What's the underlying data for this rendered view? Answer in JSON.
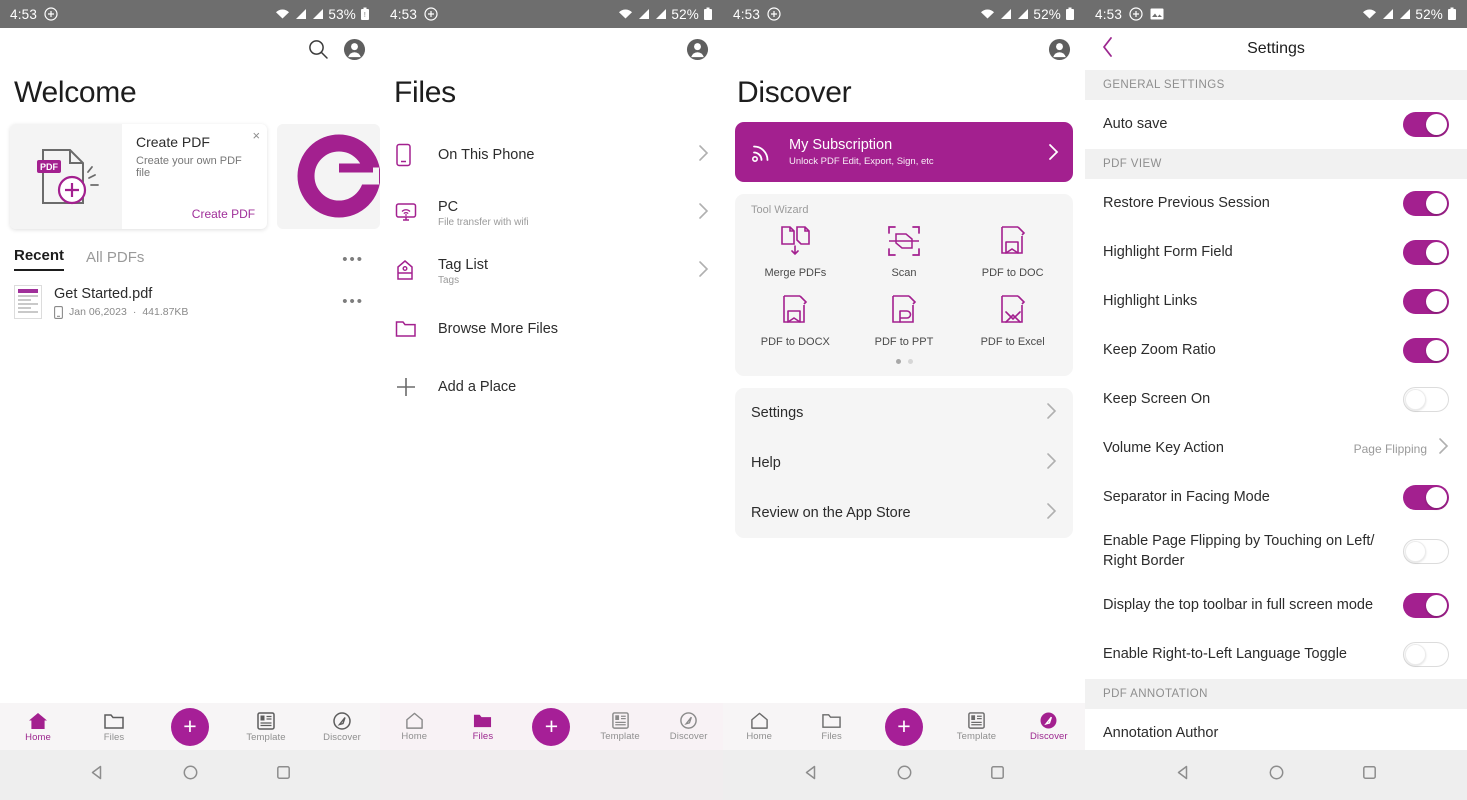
{
  "status_bar": {
    "home": {
      "time": "4:53",
      "battery": "53%",
      "icons": [
        "plus-circle-icon",
        "wifi-icon",
        "signal-icon",
        "signal-icon",
        "battery-icon"
      ]
    },
    "files": {
      "time": "4:53",
      "battery": "52%",
      "icons": [
        "plus-circle-icon",
        "wifi-icon",
        "signal-icon",
        "signal-icon",
        "battery-icon"
      ]
    },
    "discover": {
      "time": "4:53",
      "battery": "52%",
      "icons": [
        "plus-circle-icon",
        "wifi-icon",
        "signal-icon",
        "signal-icon",
        "battery-icon"
      ]
    },
    "settings": {
      "time": "4:53",
      "battery": "52%",
      "icons": [
        "plus-circle-icon",
        "image-icon",
        "wifi-icon",
        "signal-icon",
        "signal-icon",
        "battery-icon"
      ]
    }
  },
  "colors": {
    "brand_purple": "#a3208f",
    "brand_purple_light": "#9c278f",
    "status_bar_gray": "#6e6e6e",
    "nav_bar_gray": "#eeeeee",
    "card_gray": "#f5f5f5"
  },
  "home": {
    "title": "Welcome",
    "promo": {
      "title": "Create PDF",
      "subtitle": "Create your own PDF file",
      "cta": "Create PDF",
      "badge": "PDF",
      "close": "×"
    },
    "tabs": [
      {
        "label": "Recent",
        "active": true
      },
      {
        "label": "All PDFs",
        "active": false
      }
    ],
    "overflow": "•••",
    "files": [
      {
        "name": "Get Started.pdf",
        "date": "Jan 06,2023",
        "separator": "·",
        "size": "441.87KB",
        "overflow": "•••"
      }
    ]
  },
  "files": {
    "title": "Files",
    "items": [
      {
        "label": "On This Phone",
        "sub": "",
        "icon": "phone-icon",
        "chevron": true
      },
      {
        "label": "PC",
        "sub": "File transfer with wifi",
        "icon": "monitor-wifi-icon",
        "chevron": true
      },
      {
        "label": "Tag List",
        "sub": "Tags",
        "icon": "tag-icon",
        "chevron": true
      },
      {
        "label": "Browse More Files",
        "sub": "",
        "icon": "folder-icon",
        "chevron": false
      },
      {
        "label": "Add a Place",
        "sub": "",
        "icon": "plus-icon",
        "chevron": false
      }
    ]
  },
  "discover": {
    "title": "Discover",
    "subscription": {
      "title": "My Subscription",
      "subtitle": "Unlock PDF Edit, Export, Sign, etc",
      "icon": "rss-icon"
    },
    "tool_wizard": {
      "header": "Tool Wizard",
      "tools": [
        {
          "label": "Merge PDFs",
          "icon": "merge-pdfs-icon"
        },
        {
          "label": "Scan",
          "icon": "scan-icon"
        },
        {
          "label": "PDF to DOC",
          "icon": "pdf-to-doc-icon"
        },
        {
          "label": "PDF to DOCX",
          "icon": "pdf-to-docx-icon"
        },
        {
          "label": "PDF to PPT",
          "icon": "pdf-to-ppt-icon"
        },
        {
          "label": "PDF to Excel",
          "icon": "pdf-to-excel-icon"
        }
      ],
      "page_dots": 2,
      "active_dot": 0
    },
    "menu": [
      {
        "label": "Settings"
      },
      {
        "label": "Help"
      },
      {
        "label": "Review on the App Store"
      }
    ]
  },
  "settings": {
    "title": "Settings",
    "back_icon": "chevron-left-icon",
    "sections": [
      {
        "header": "GENERAL SETTINGS",
        "rows": [
          {
            "label": "Auto save",
            "control": "toggle",
            "value": true
          }
        ]
      },
      {
        "header": "PDF VIEW",
        "rows": [
          {
            "label": "Restore Previous Session",
            "control": "toggle",
            "value": true
          },
          {
            "label": "Highlight Form Field",
            "control": "toggle",
            "value": true
          },
          {
            "label": "Highlight Links",
            "control": "toggle",
            "value": true
          },
          {
            "label": "Keep Zoom Ratio",
            "control": "toggle",
            "value": true
          },
          {
            "label": "Keep Screen On",
            "control": "toggle",
            "value": false
          },
          {
            "label": "Volume Key Action",
            "control": "value",
            "value": "Page Flipping"
          },
          {
            "label": "Separator in Facing Mode",
            "control": "toggle",
            "value": true
          },
          {
            "label": "Enable Page Flipping by Touching on Left/ Right Border",
            "control": "toggle",
            "value": false
          },
          {
            "label": "Display the top toolbar in full screen mode",
            "control": "toggle",
            "value": true
          },
          {
            "label": "Enable Right-to-Left Language Toggle",
            "control": "toggle",
            "value": false
          }
        ]
      },
      {
        "header": "PDF ANNOTATION",
        "rows": [
          {
            "label": "Annotation Author",
            "control": "none",
            "value": ""
          }
        ]
      }
    ]
  },
  "tabbar": {
    "items": [
      {
        "label": "Home",
        "icon": "home-icon"
      },
      {
        "label": "Files",
        "icon": "folder-icon"
      },
      {
        "label": "",
        "icon": "plus-fab-icon"
      },
      {
        "label": "Template",
        "icon": "template-icon"
      },
      {
        "label": "Discover",
        "icon": "compass-icon"
      }
    ],
    "active": {
      "home": "Home",
      "files": "Files",
      "discover": "Discover"
    }
  },
  "android_nav": {
    "back": "back-triangle-icon",
    "home": "home-circle-icon",
    "recents": "recents-square-icon"
  }
}
